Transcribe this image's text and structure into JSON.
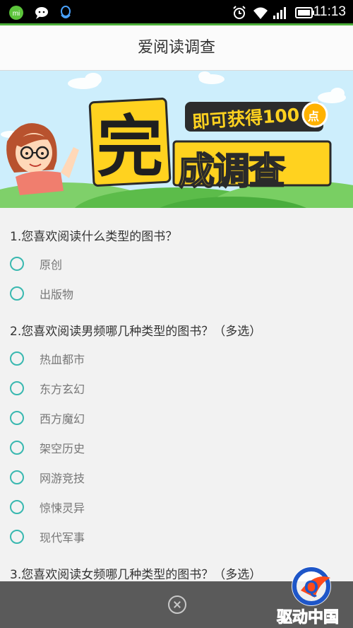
{
  "status_bar": {
    "time": "11:13",
    "icons": [
      "mi-icon",
      "chat-icon",
      "qq-icon",
      "alarm-icon",
      "wifi-icon",
      "signal-icon",
      "battery-icon"
    ]
  },
  "header": {
    "title": "爱阅读调查"
  },
  "banner": {
    "subtitle": "即可获得100",
    "badge": "点",
    "headline": "完成调查"
  },
  "questions": [
    {
      "title": "1.您喜欢阅读什么类型的图书？",
      "options": [
        "原创",
        "出版物"
      ]
    },
    {
      "title": "2.您喜欢阅读男频哪几种类型的图书？（多选）",
      "options": [
        "热血都市",
        "东方玄幻",
        "西方魔幻",
        "架空历史",
        "网游竞技",
        "惊悚灵异",
        "现代军事"
      ]
    },
    {
      "title": "3.您喜欢阅读女频哪几种类型的图书？（多选）",
      "options": []
    }
  ],
  "watermark": {
    "text": "驱动中国"
  },
  "colors": {
    "accent": "#39b8b0",
    "status_line": "#4caf3a",
    "bottom_bar": "#5a5a5a"
  }
}
